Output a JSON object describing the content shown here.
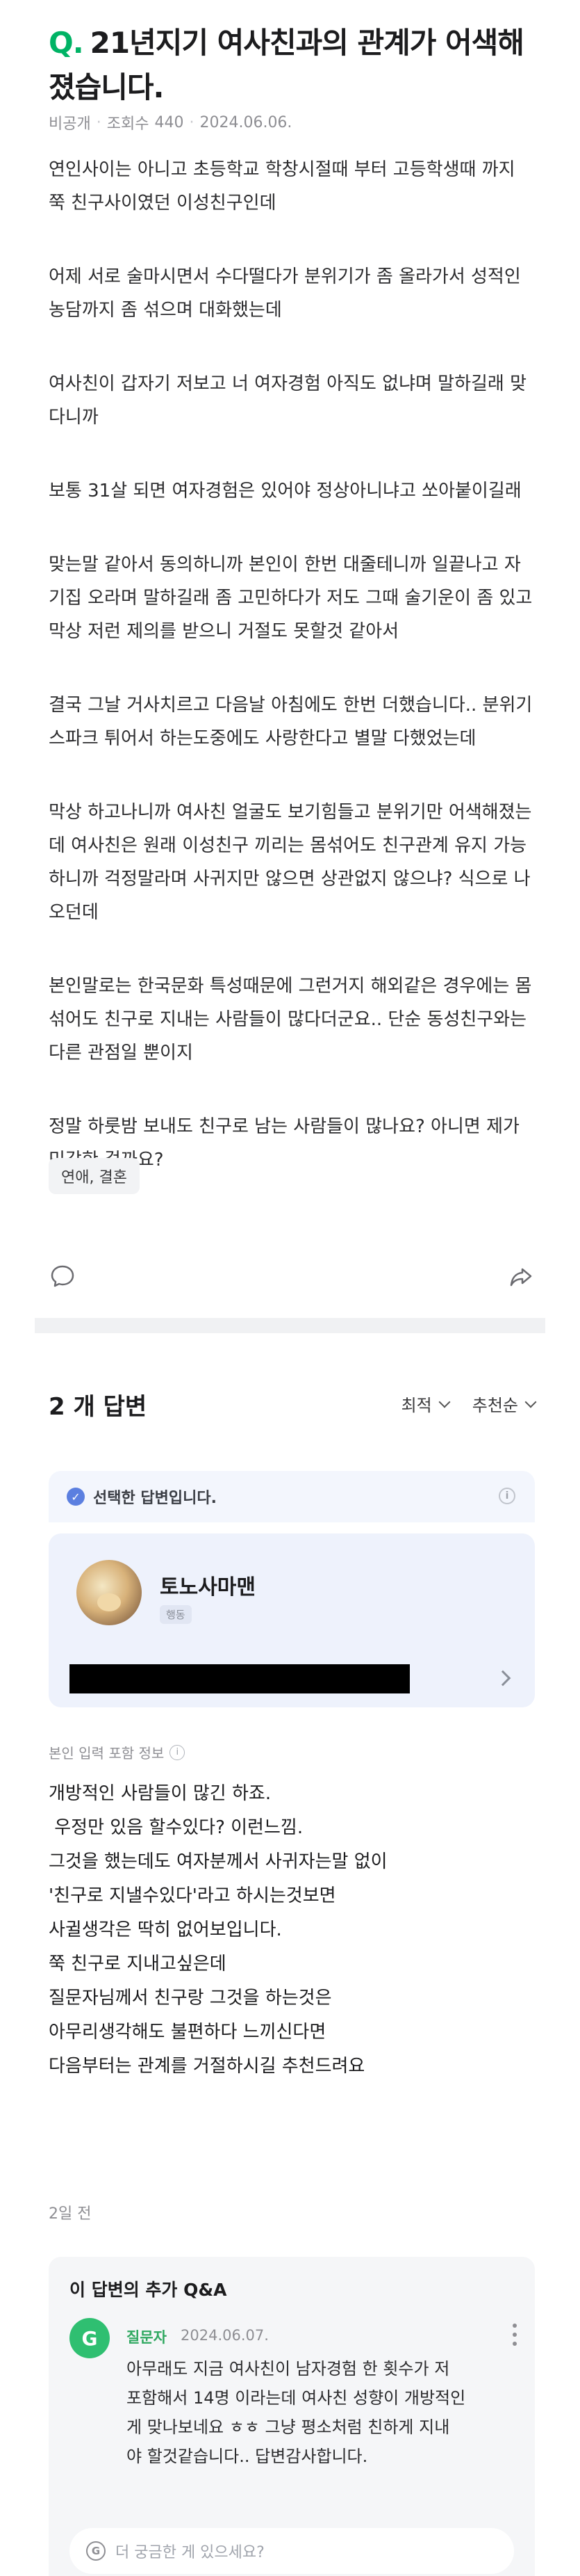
{
  "question": {
    "mark": "Q.",
    "title": "21년지기 여사친과의 관계가 어색해 졌습니다.",
    "visibility": "비공개",
    "views_label": "조회수",
    "views": "440",
    "date": "2024.06.06.",
    "paragraphs": [
      "연인사이는 아니고 초등학교 학창시절때 부터 고등학생때 까지 쭉 친구사이였던 이성친구인데",
      "어제 서로 술마시면서 수다떨다가 분위기가 좀 올라가서 성적인 농담까지 좀 섞으며 대화했는데",
      "여사친이 갑자기 저보고 너 여자경험 아직도 없냐며 말하길래 맞다니까",
      "보통 31살 되면 여자경험은 있어야 정상아니냐고 쏘아붙이길래",
      "맞는말 같아서 동의하니까 본인이 한번 대줄테니까 일끝나고 자기집 오라며 말하길래 좀 고민하다가 저도 그때 술기운이 좀 있고 막상 저런 제의를 받으니 거절도 못할것 같아서",
      "결국 그날 거사치르고 다음날 아침에도 한번 더했습니다.. 분위기 스파크 튀어서 하는도중에도 사랑한다고 별말 다했었는데",
      "막상 하고나니까 여사친 얼굴도 보기힘들고 분위기만 어색해졌는데 여사친은 원래 이성친구 끼리는 몸섞어도 친구관계 유지 가능하니까 걱정말라며 사귀지만 않으면 상관없지 않으냐? 식으로 나오던데",
      "본인말로는 한국문화 특성때문에 그런거지 해외같은 경우에는 몸섞어도 친구로 지내는 사람들이 많다더군요.. 단순 동성친구와는 다른 관점일 뿐이지",
      "정말 하룻밤 보내도 친구로 남는 사람들이 많나요? 아니면 제가 민감한 걸까요?"
    ],
    "tag": "연애, 결혼"
  },
  "answers": {
    "count_label": "2 개 답변",
    "sort_recent": "최적",
    "sort_recommend": "추천순",
    "selected_label": "선택한 답변입니다.",
    "answerer_name": "토노사마맨",
    "answerer_role": "행동",
    "included_info": "본인 입력 포함 정보",
    "body_lines": [
      "개방적인 사람들이 많긴 하죠.",
      " 우정만 있음 할수있다? 이런느낌.",
      "그것을 했는데도 여자분께서 사귀자는말 없이",
      "'친구로 지낼수있다'라고 하시는것보면",
      "사귈생각은 딱히 없어보입니다.",
      "쭉 친구로 지내고싶은데",
      "질문자님께서 친구랑 그것을 하는것은",
      "아무리생각해도 불편하다 느끼신다면",
      "다음부터는 관계를 거절하시길 추천드려요"
    ],
    "date_ago": "2일 전"
  },
  "followup": {
    "title": "이 답변의 추가 Q&A",
    "avatar_letter": "G",
    "role": "질문자",
    "date": "2024.06.07.",
    "text_lines": [
      "아무래도 지금 여사친이 남자경험 한 횟수가 저",
      "포함해서 14명 이라는데 여사친 성향이 개방적인",
      "게 맞나보네요 ㅎㅎ 그냥 평소처럼 친하게 지내",
      "야 할것같습니다.. 답변감사합니다."
    ],
    "input_placeholder": "더 궁금한 게 있으세요?"
  },
  "colors": {
    "accent_green": "#00b365",
    "selected_blue": "#5b7fe0"
  }
}
